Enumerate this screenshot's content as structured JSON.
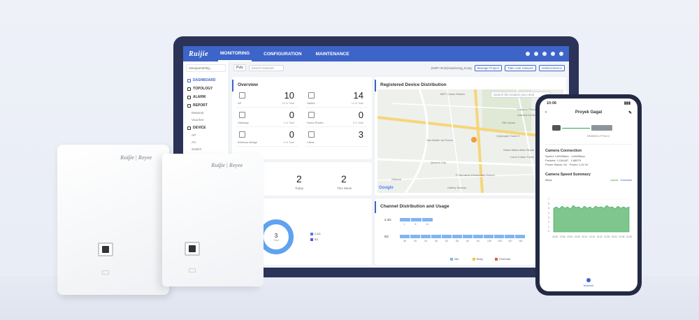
{
  "tablet": {
    "logo": "Ruijie",
    "nav": [
      "MONITORING",
      "CONFIGURATION",
      "MAINTENANCE"
    ],
    "sidebar": {
      "account": "reteuipomtOhg...",
      "items": [
        {
          "label": "DASHBOARD",
          "active": true
        },
        {
          "label": "TOPOLOGY",
          "active": false
        },
        {
          "label": "ALARM",
          "active": false
        },
        {
          "label": "REPORT",
          "active": false
        }
      ],
      "report_sub": [
        "Network",
        "Voucher"
      ],
      "device_label": "DEVICE",
      "device_sub": [
        "AP",
        "AC",
        "Switch"
      ]
    },
    "toolbar": {
      "project": "Pvtz",
      "search_placeholder": "Search Network",
      "timezone": "(GMT+8:00)Asia/Hong_Kong",
      "buttons": [
        "Manage Project",
        "Take over network",
        "Unbind Device"
      ]
    },
    "overview": {
      "title": "Overview",
      "items": [
        {
          "label": "AP",
          "value": "10",
          "sub": "10 in Total"
        },
        {
          "label": "Switch",
          "value": "14",
          "sub": "14 in Total"
        },
        {
          "label": "Gateway",
          "value": "0",
          "sub": "0 in Total"
        },
        {
          "label": "Home Router",
          "value": "0",
          "sub": "0 in Total"
        },
        {
          "label": "Wireless Bridge",
          "value": "0",
          "sub": "0 in Total"
        },
        {
          "label": "Client",
          "value": "3",
          "sub": ""
        }
      ]
    },
    "clients_counts": [
      {
        "value": "2",
        "label": "Today"
      },
      {
        "value": "2",
        "label": "This Week"
      }
    ],
    "map": {
      "title": "Registered Device Distribution",
      "search_placeholder": "Search the location you need",
      "labels": [
        "MRT Cubao Station",
        "Farmers Plaza",
        "Araneta Center",
        "Cyberpark Tower 2",
        "San Martin de Porres",
        "Gilmore",
        "P. Bernardo Elementary School",
        "Gallery Mosaiq",
        "SM Cubao",
        "Santa Maria della Strada",
        "Lions Cubao Tower",
        "Quezon City",
        "Google"
      ]
    },
    "clients_ring": {
      "title": "nts",
      "value": "3",
      "label": "Total",
      "legend": [
        "2.4G",
        "5G"
      ]
    },
    "channel": {
      "title": "Channel Distribution and Usage",
      "band1": "2.4G",
      "band2": "5G",
      "ch24": [
        "1",
        "6",
        "11"
      ],
      "ch5": [
        "36",
        "40",
        "44",
        "48",
        "52",
        "56",
        "60",
        "64",
        "149",
        "153",
        "157",
        "161"
      ],
      "legend": [
        "Idle",
        "Busy",
        "Overload"
      ]
    },
    "colors": {
      "accent": "#3d64c8",
      "ring": "#5ea2f0",
      "legend_24": "#4a7be0",
      "legend_5": "#6b4fd6",
      "idle": "#7fb5f2",
      "busy": "#f6c142",
      "overload": "#e55a4a"
    }
  },
  "ap1": {
    "brand": "Ruijie | Reyee",
    "slot": "LAN"
  },
  "ap2": {
    "brand": "Ruijie | Reyee",
    "slot": "LAN"
  },
  "phone": {
    "time": "10:06",
    "title": "Proyek Gagal",
    "device_caption": "ES209GC-P Port 2",
    "connection_title": "Camera Connection",
    "rows": [
      {
        "k": "Speed",
        "v": "1:652Mbps",
        "k2": "",
        "v2": "1:662Mbps"
      },
      {
        "k": "Packets",
        "v": "1:154467",
        "k2": "",
        "v2": "1:66579"
      },
      {
        "k": "Power Status",
        "v": "On",
        "k2": "Power",
        "v2": "2.61 W"
      }
    ],
    "speed_title": "Camera Speed Summary",
    "unit": "Mbps",
    "legend": [
      "Uplink",
      "Downlink"
    ],
    "y_ticks": [
      "7",
      "6",
      "5",
      "4",
      "3",
      "2",
      "1",
      "0"
    ],
    "x_ticks": [
      "21:50",
      "21:55",
      "22:00",
      "22:05",
      "22:10",
      "22:15",
      "22:20",
      "22:25",
      "22:30",
      "22:35",
      "22:40"
    ],
    "bottom_nav": "Network"
  }
}
